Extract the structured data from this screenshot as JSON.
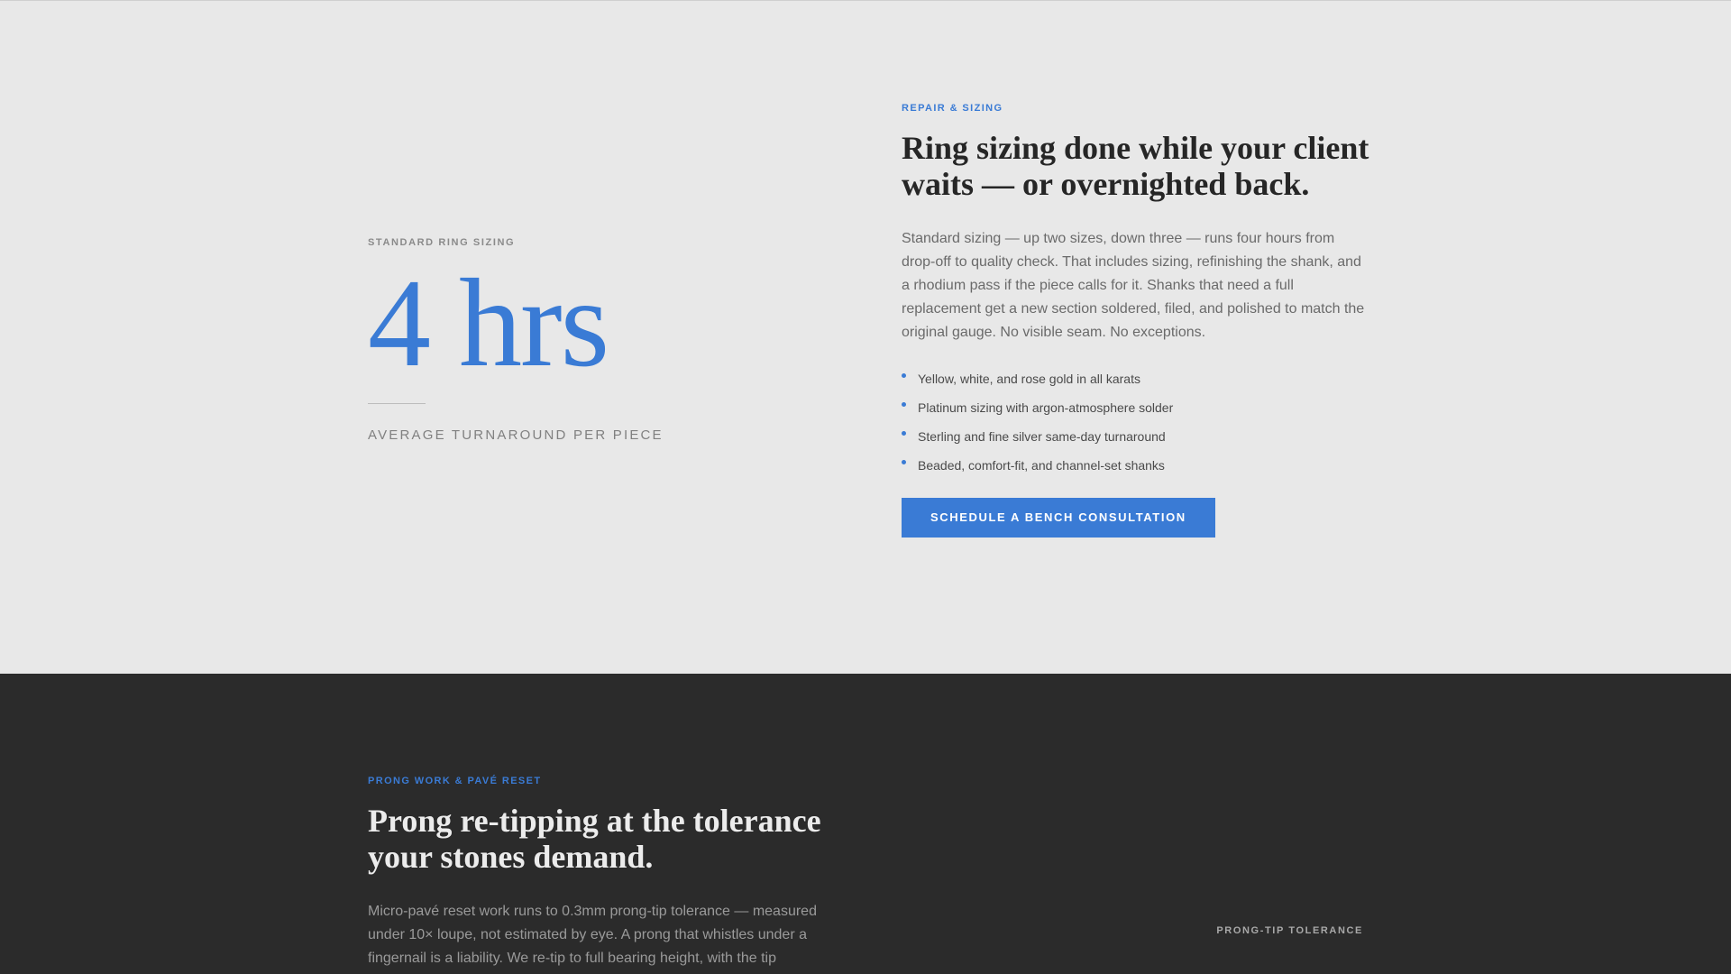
{
  "sizing_section": {
    "stat_eyebrow": "STANDARD RING SIZING",
    "stat_value": "4 hrs",
    "stat_caption": "AVERAGE TURNAROUND PER PIECE",
    "eyebrow": "REPAIR & SIZING",
    "headline": "Ring sizing done while your client waits — or overnighted back.",
    "body": "Standard sizing — up two sizes, down three — runs four hours from drop-off to quality check. That includes sizing, refinishing the shank, and a rhodium pass if the piece calls for it. Shanks that need a full replacement get a new section soldered, filed, and polished to match the original gauge. No visible seam. No exceptions.",
    "bullets": [
      "Yellow, white, and rose gold in all karats",
      "Platinum sizing with argon-atmosphere solder",
      "Sterling and fine silver same-day turnaround",
      "Beaded, comfort-fit, and channel-set shanks"
    ],
    "cta_label": "SCHEDULE A BENCH CONSULTATION"
  },
  "prong_section": {
    "eyebrow": "PRONG WORK & PAVÉ RESET",
    "headline": "Prong re-tipping at the tolerance your stones demand.",
    "body": "Micro-pavé reset work runs to 0.3mm prong-tip tolerance — measured under 10× loupe, not estimated by eye. A prong that whistles under a fingernail is a liability. We re-tip to full bearing height, with the tip",
    "stat_label": "PRONG-TIP TOLERANCE"
  },
  "colors": {
    "accent": "#3a7bd5",
    "light_bg": "#e8e8e8",
    "dark_bg": "#2b2b2b"
  }
}
